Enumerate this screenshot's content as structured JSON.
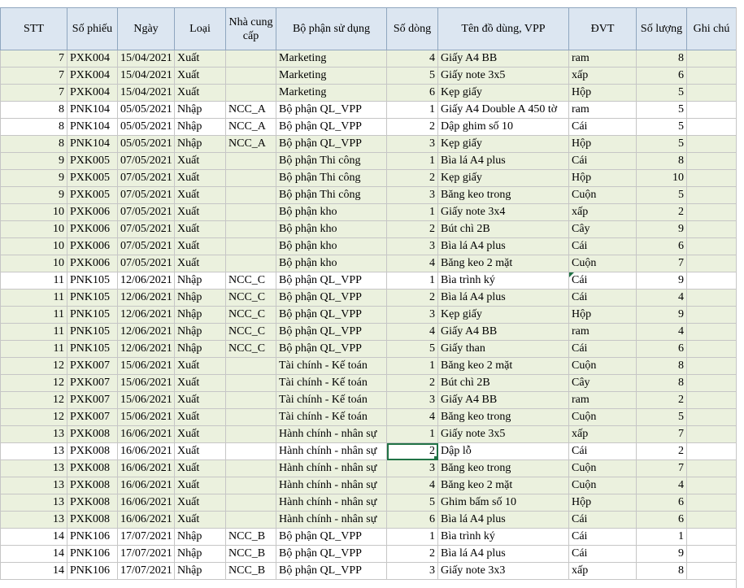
{
  "headers": [
    "STT",
    "Số phiếu",
    "Ngày",
    "Loại",
    "Nhà cung cấp",
    "Bộ phận sử dụng",
    "Số dòng",
    "Tên đồ dùng, VPP",
    "ĐVT",
    "Số lượng",
    "Ghi chú"
  ],
  "rows": [
    {
      "stt": "7",
      "so_phieu": "PXK004",
      "ngay": "15/04/2021",
      "loai": "Xuất",
      "ncc": "",
      "bo_phan": "Marketing",
      "so_dong": "4",
      "ten": "Giấy A4 BB",
      "dvt": "ram",
      "so_luong": "8",
      "ghi_chu": ""
    },
    {
      "stt": "7",
      "so_phieu": "PXK004",
      "ngay": "15/04/2021",
      "loai": "Xuất",
      "ncc": "",
      "bo_phan": "Marketing",
      "so_dong": "5",
      "ten": "Giấy note 3x5",
      "dvt": "xấp",
      "so_luong": "6",
      "ghi_chu": ""
    },
    {
      "stt": "7",
      "so_phieu": "PXK004",
      "ngay": "15/04/2021",
      "loai": "Xuất",
      "ncc": "",
      "bo_phan": "Marketing",
      "so_dong": "6",
      "ten": "Kẹp giấy",
      "dvt": "Hộp",
      "so_luong": "5",
      "ghi_chu": ""
    },
    {
      "stt": "8",
      "so_phieu": "PNK104",
      "ngay": "05/05/2021",
      "loai": "Nhập",
      "ncc": "NCC_A",
      "bo_phan": "Bộ phận QL_VPP",
      "so_dong": "1",
      "ten": "Giấy A4 Double A 450 tờ",
      "dvt": "ram",
      "so_luong": "5",
      "ghi_chu": ""
    },
    {
      "stt": "8",
      "so_phieu": "PNK104",
      "ngay": "05/05/2021",
      "loai": "Nhập",
      "ncc": "NCC_A",
      "bo_phan": "Bộ phận QL_VPP",
      "so_dong": "2",
      "ten": "Dập ghim số 10",
      "dvt": "Cái",
      "so_luong": "5",
      "ghi_chu": ""
    },
    {
      "stt": "8",
      "so_phieu": "PNK104",
      "ngay": "05/05/2021",
      "loai": "Nhập",
      "ncc": "NCC_A",
      "bo_phan": "Bộ phận QL_VPP",
      "so_dong": "3",
      "ten": "Kẹp giấy",
      "dvt": "Hộp",
      "so_luong": "5",
      "ghi_chu": ""
    },
    {
      "stt": "9",
      "so_phieu": "PXK005",
      "ngay": "07/05/2021",
      "loai": "Xuất",
      "ncc": "",
      "bo_phan": "Bộ phận Thi công",
      "so_dong": "1",
      "ten": "Bìa lá A4 plus",
      "dvt": "Cái",
      "so_luong": "8",
      "ghi_chu": ""
    },
    {
      "stt": "9",
      "so_phieu": "PXK005",
      "ngay": "07/05/2021",
      "loai": "Xuất",
      "ncc": "",
      "bo_phan": "Bộ phận Thi công",
      "so_dong": "2",
      "ten": "Kẹp giấy",
      "dvt": "Hộp",
      "so_luong": "10",
      "ghi_chu": ""
    },
    {
      "stt": "9",
      "so_phieu": "PXK005",
      "ngay": "07/05/2021",
      "loai": "Xuất",
      "ncc": "",
      "bo_phan": "Bộ phận Thi công",
      "so_dong": "3",
      "ten": "Băng keo trong",
      "dvt": "Cuộn",
      "so_luong": "5",
      "ghi_chu": ""
    },
    {
      "stt": "10",
      "so_phieu": "PXK006",
      "ngay": "07/05/2021",
      "loai": "Xuất",
      "ncc": "",
      "bo_phan": "Bộ phận kho",
      "so_dong": "1",
      "ten": "Giấy note 3x4",
      "dvt": "xấp",
      "so_luong": "2",
      "ghi_chu": ""
    },
    {
      "stt": "10",
      "so_phieu": "PXK006",
      "ngay": "07/05/2021",
      "loai": "Xuất",
      "ncc": "",
      "bo_phan": "Bộ phận kho",
      "so_dong": "2",
      "ten": "Bút chì 2B",
      "dvt": "Cây",
      "so_luong": "9",
      "ghi_chu": ""
    },
    {
      "stt": "10",
      "so_phieu": "PXK006",
      "ngay": "07/05/2021",
      "loai": "Xuất",
      "ncc": "",
      "bo_phan": "Bộ phận kho",
      "so_dong": "3",
      "ten": "Bìa lá A4 plus",
      "dvt": "Cái",
      "so_luong": "6",
      "ghi_chu": ""
    },
    {
      "stt": "10",
      "so_phieu": "PXK006",
      "ngay": "07/05/2021",
      "loai": "Xuất",
      "ncc": "",
      "bo_phan": "Bộ phận kho",
      "so_dong": "4",
      "ten": "Băng keo 2 mặt",
      "dvt": "Cuộn",
      "so_luong": "7",
      "ghi_chu": ""
    },
    {
      "stt": "11",
      "so_phieu": "PNK105",
      "ngay": "12/06/2021",
      "loai": "Nhập",
      "ncc": "NCC_C",
      "bo_phan": "Bộ phận QL_VPP",
      "so_dong": "1",
      "ten": "Bìa trình ký",
      "dvt": "Cái",
      "so_luong": "9",
      "ghi_chu": ""
    },
    {
      "stt": "11",
      "so_phieu": "PNK105",
      "ngay": "12/06/2021",
      "loai": "Nhập",
      "ncc": "NCC_C",
      "bo_phan": "Bộ phận QL_VPP",
      "so_dong": "2",
      "ten": "Bìa lá A4 plus",
      "dvt": "Cái",
      "so_luong": "4",
      "ghi_chu": ""
    },
    {
      "stt": "11",
      "so_phieu": "PNK105",
      "ngay": "12/06/2021",
      "loai": "Nhập",
      "ncc": "NCC_C",
      "bo_phan": "Bộ phận QL_VPP",
      "so_dong": "3",
      "ten": "Kẹp giấy",
      "dvt": "Hộp",
      "so_luong": "9",
      "ghi_chu": ""
    },
    {
      "stt": "11",
      "so_phieu": "PNK105",
      "ngay": "12/06/2021",
      "loai": "Nhập",
      "ncc": "NCC_C",
      "bo_phan": "Bộ phận QL_VPP",
      "so_dong": "4",
      "ten": "Giấy A4 BB",
      "dvt": "ram",
      "so_luong": "4",
      "ghi_chu": ""
    },
    {
      "stt": "11",
      "so_phieu": "PNK105",
      "ngay": "12/06/2021",
      "loai": "Nhập",
      "ncc": "NCC_C",
      "bo_phan": "Bộ phận QL_VPP",
      "so_dong": "5",
      "ten": "Giấy than",
      "dvt": "Cái",
      "so_luong": "6",
      "ghi_chu": ""
    },
    {
      "stt": "12",
      "so_phieu": "PXK007",
      "ngay": "15/06/2021",
      "loai": "Xuất",
      "ncc": "",
      "bo_phan": "Tài chính - Kế toán",
      "so_dong": "1",
      "ten": "Băng keo 2 mặt",
      "dvt": "Cuộn",
      "so_luong": "8",
      "ghi_chu": ""
    },
    {
      "stt": "12",
      "so_phieu": "PXK007",
      "ngay": "15/06/2021",
      "loai": "Xuất",
      "ncc": "",
      "bo_phan": "Tài chính - Kế toán",
      "so_dong": "2",
      "ten": "Bút chì 2B",
      "dvt": "Cây",
      "so_luong": "8",
      "ghi_chu": ""
    },
    {
      "stt": "12",
      "so_phieu": "PXK007",
      "ngay": "15/06/2021",
      "loai": "Xuất",
      "ncc": "",
      "bo_phan": "Tài chính - Kế toán",
      "so_dong": "3",
      "ten": "Giấy A4 BB",
      "dvt": "ram",
      "so_luong": "2",
      "ghi_chu": ""
    },
    {
      "stt": "12",
      "so_phieu": "PXK007",
      "ngay": "15/06/2021",
      "loai": "Xuất",
      "ncc": "",
      "bo_phan": "Tài chính - Kế toán",
      "so_dong": "4",
      "ten": "Băng keo trong",
      "dvt": "Cuộn",
      "so_luong": "5",
      "ghi_chu": ""
    },
    {
      "stt": "13",
      "so_phieu": "PXK008",
      "ngay": "16/06/2021",
      "loai": "Xuất",
      "ncc": "",
      "bo_phan": "Hành chính - nhân sự",
      "so_dong": "1",
      "ten": "Giấy note 3x5",
      "dvt": "xấp",
      "so_luong": "7",
      "ghi_chu": ""
    },
    {
      "stt": "13",
      "so_phieu": "PXK008",
      "ngay": "16/06/2021",
      "loai": "Xuất",
      "ncc": "",
      "bo_phan": "Hành chính - nhân sự",
      "so_dong": "2",
      "ten": "Dập lỗ",
      "dvt": "Cái",
      "so_luong": "2",
      "ghi_chu": ""
    },
    {
      "stt": "13",
      "so_phieu": "PXK008",
      "ngay": "16/06/2021",
      "loai": "Xuất",
      "ncc": "",
      "bo_phan": "Hành chính - nhân sự",
      "so_dong": "3",
      "ten": "Băng keo trong",
      "dvt": "Cuộn",
      "so_luong": "7",
      "ghi_chu": ""
    },
    {
      "stt": "13",
      "so_phieu": "PXK008",
      "ngay": "16/06/2021",
      "loai": "Xuất",
      "ncc": "",
      "bo_phan": "Hành chính - nhân sự",
      "so_dong": "4",
      "ten": "Băng keo 2 mặt",
      "dvt": "Cuộn",
      "so_luong": "4",
      "ghi_chu": ""
    },
    {
      "stt": "13",
      "so_phieu": "PXK008",
      "ngay": "16/06/2021",
      "loai": "Xuất",
      "ncc": "",
      "bo_phan": "Hành chính - nhân sự",
      "so_dong": "5",
      "ten": "Ghim bấm số 10",
      "dvt": "Hộp",
      "so_luong": "6",
      "ghi_chu": ""
    },
    {
      "stt": "13",
      "so_phieu": "PXK008",
      "ngay": "16/06/2021",
      "loai": "Xuất",
      "ncc": "",
      "bo_phan": "Hành chính - nhân sự",
      "so_dong": "6",
      "ten": "Bìa lá A4 plus",
      "dvt": "Cái",
      "so_luong": "6",
      "ghi_chu": ""
    },
    {
      "stt": "14",
      "so_phieu": "PNK106",
      "ngay": "17/07/2021",
      "loai": "Nhập",
      "ncc": "NCC_B",
      "bo_phan": "Bộ phận QL_VPP",
      "so_dong": "1",
      "ten": "Bìa trình ký",
      "dvt": "Cái",
      "so_luong": "1",
      "ghi_chu": ""
    },
    {
      "stt": "14",
      "so_phieu": "PNK106",
      "ngay": "17/07/2021",
      "loai": "Nhập",
      "ncc": "NCC_B",
      "bo_phan": "Bộ phận QL_VPP",
      "so_dong": "2",
      "ten": "Bìa lá A4 plus",
      "dvt": "Cái",
      "so_luong": "9",
      "ghi_chu": ""
    },
    {
      "stt": "14",
      "so_phieu": "PNK106",
      "ngay": "17/07/2021",
      "loai": "Nhập",
      "ncc": "NCC_B",
      "bo_phan": "Bộ phận QL_VPP",
      "so_dong": "3",
      "ten": "Giấy note 3x3",
      "dvt": "xấp",
      "so_luong": "8",
      "ghi_chu": ""
    }
  ],
  "highlight_color": "#ebf1de",
  "header_color": "#dce6f1",
  "selection_color": "#217346"
}
